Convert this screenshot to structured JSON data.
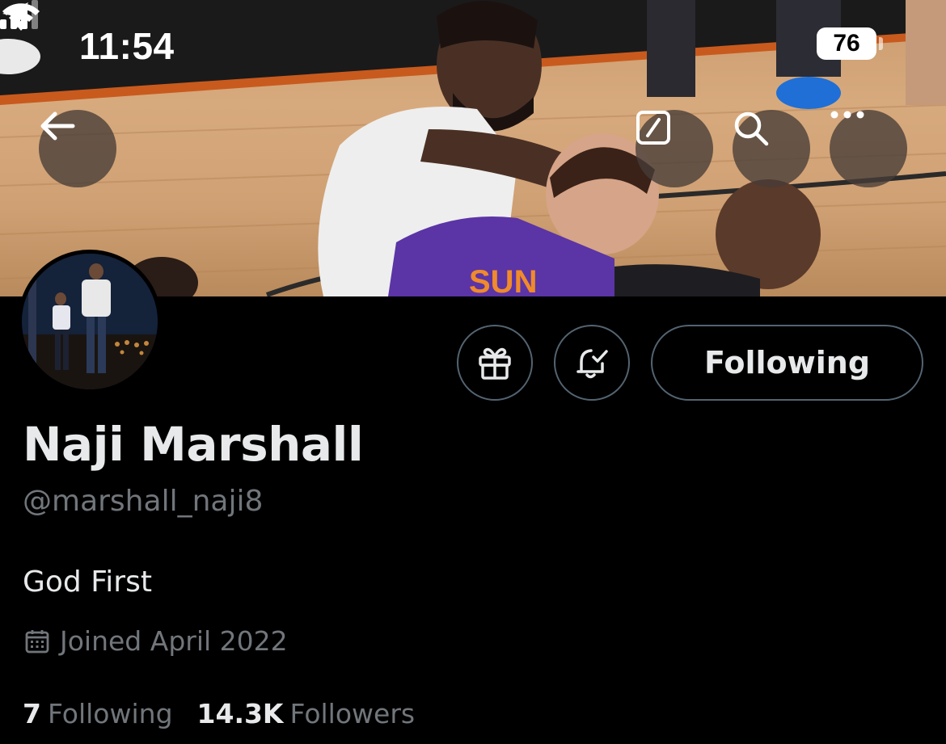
{
  "status_bar": {
    "time": "11:54",
    "battery": "76"
  },
  "banner": {
    "icons": [
      "back-arrow-icon",
      "edit-icon",
      "search-icon",
      "more-icon"
    ]
  },
  "profile": {
    "display_name": "Naji Marshall",
    "handle": "@marshall_naji8",
    "bio": "God First",
    "joined": "Joined April 2022"
  },
  "actions": {
    "following_label": "Following",
    "icons": [
      "gift-icon",
      "bell-check-icon"
    ]
  },
  "stats": {
    "following_count": "7",
    "following_label": "Following",
    "followers_count": "14.3K",
    "followers_label": "Followers"
  },
  "colors": {
    "background": "#000000",
    "primary_text": "#e7e9ea",
    "secondary_text": "#71767b",
    "border": "#536471"
  }
}
